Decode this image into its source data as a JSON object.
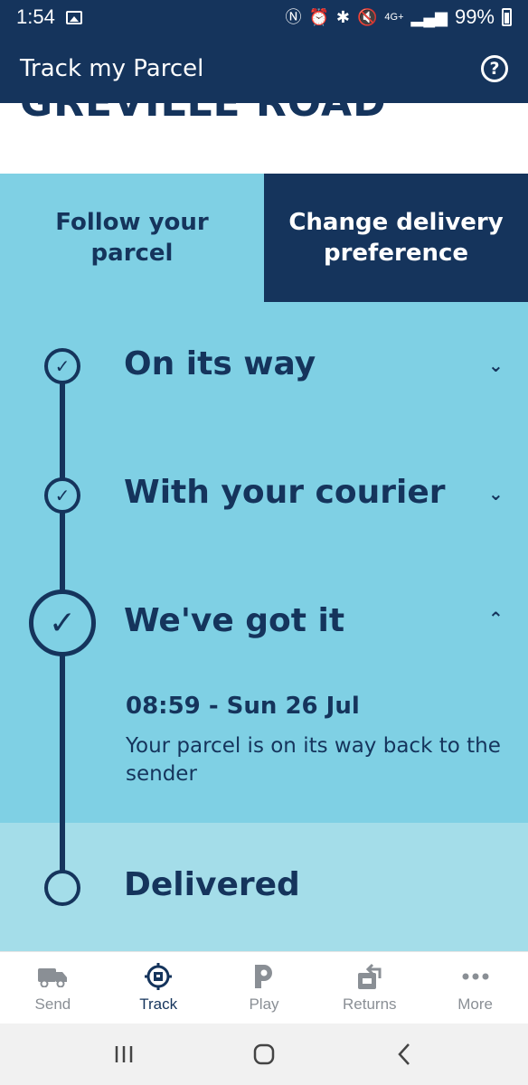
{
  "status_bar": {
    "time": "1:54",
    "network": "4G+",
    "battery": "99%"
  },
  "app_bar": {
    "title": "Track my Parcel"
  },
  "address": {
    "text": "GREVILLE ROAD"
  },
  "tabs": [
    {
      "label": "Follow your parcel",
      "active": false
    },
    {
      "label": "Change delivery preference",
      "active": true
    }
  ],
  "timeline": {
    "steps": [
      {
        "title": "On its way",
        "completed": true,
        "expanded": false
      },
      {
        "title": "With your courier",
        "completed": true,
        "expanded": false
      },
      {
        "title": "We've got it",
        "completed": true,
        "expanded": true
      },
      {
        "title": "Delivered",
        "completed": false,
        "expanded": false
      }
    ],
    "detail": {
      "time": "08:59 - Sun 26 Jul",
      "message": "Your parcel is on its way back to the sender"
    }
  },
  "bottom_nav": [
    {
      "label": "Send",
      "icon": "van-icon",
      "active": false
    },
    {
      "label": "Track",
      "icon": "track-icon",
      "active": true
    },
    {
      "label": "Play",
      "icon": "play-p-icon",
      "active": false
    },
    {
      "label": "Returns",
      "icon": "returns-icon",
      "active": false
    },
    {
      "label": "More",
      "icon": "more-dots-icon",
      "active": false
    }
  ],
  "colors": {
    "navy": "#15345c",
    "light_blue": "#7fd0e4",
    "pale_blue": "#a4dde9",
    "inactive_grey": "#8a8f95"
  }
}
